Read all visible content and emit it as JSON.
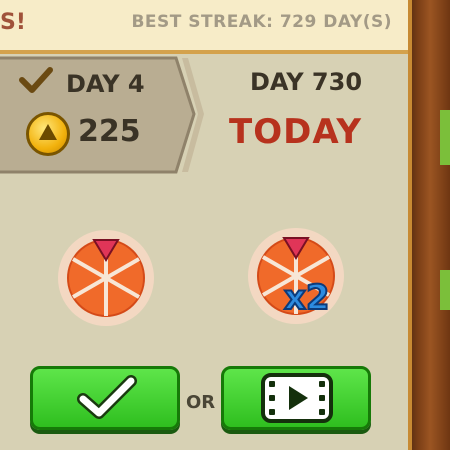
{
  "header": {
    "left_fragment": "S!",
    "best_streak": "BEST STREAK: 729 DAY(S)"
  },
  "previous_day": {
    "day_label": "DAY 4",
    "coins": "225"
  },
  "current_day": {
    "day_label": "DAY 730",
    "status": "TODAY"
  },
  "rewards": [
    {
      "icon": "spin-wheel-icon"
    },
    {
      "icon": "spin-wheel-icon",
      "multiplier": "x2"
    }
  ],
  "actions": {
    "or_label": "OR",
    "claim_icon": "checkmark-icon",
    "video_icon": "video-icon"
  },
  "colors": {
    "today": "#b7321d",
    "button_green": "#3fd02a",
    "multiplier_blue": "#2d8be0"
  }
}
